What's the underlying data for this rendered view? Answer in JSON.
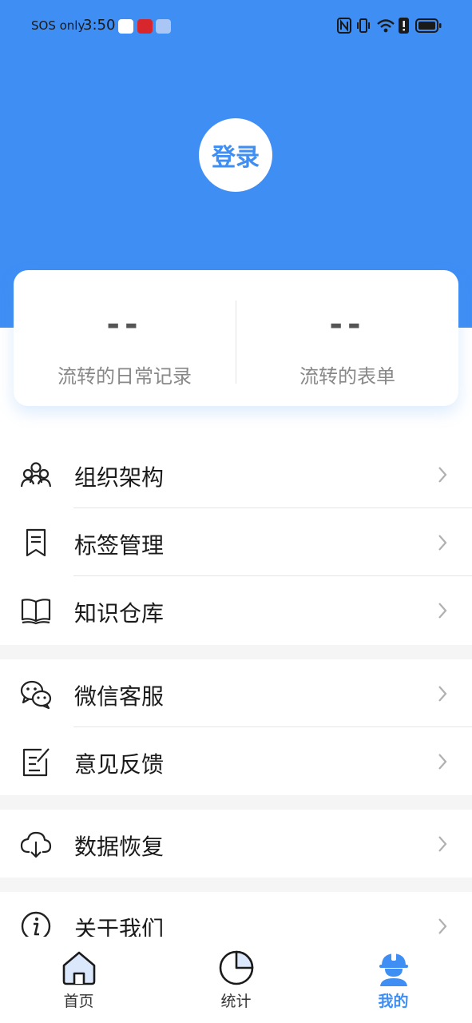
{
  "status_bar": {
    "carrier": "SOS only",
    "time": "3:50"
  },
  "header": {
    "login_label": "登录"
  },
  "stats": [
    {
      "value": "--",
      "label": "流转的日常记录"
    },
    {
      "value": "--",
      "label": "流转的表单"
    }
  ],
  "menu": {
    "section1": [
      {
        "label": "组织架构",
        "icon": "organization-icon"
      },
      {
        "label": "标签管理",
        "icon": "bookmark-icon"
      },
      {
        "label": "知识仓库",
        "icon": "book-icon"
      }
    ],
    "section2": [
      {
        "label": "微信客服",
        "icon": "wechat-icon"
      },
      {
        "label": "意见反馈",
        "icon": "feedback-icon"
      }
    ],
    "section3": [
      {
        "label": "数据恢复",
        "icon": "cloud-download-icon"
      }
    ],
    "section4": [
      {
        "label": "关于我们",
        "icon": "info-icon"
      }
    ]
  },
  "bottom_nav": [
    {
      "label": "首页",
      "icon": "home-icon"
    },
    {
      "label": "统计",
      "icon": "pie-chart-icon"
    },
    {
      "label": "我的",
      "icon": "worker-helmet-icon",
      "active": true
    }
  ],
  "colors": {
    "primary": "#3f8ef4",
    "background": "#f5f5f5"
  }
}
